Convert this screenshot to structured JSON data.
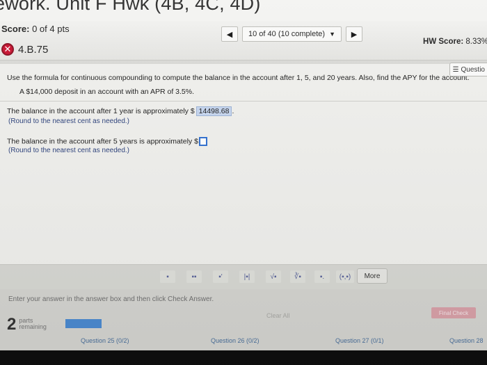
{
  "title": "ework. Unit F Hwk (4B, 4C, 4D)",
  "toolbar": {
    "score_label": "Score:",
    "score_value": "0 of 4 pts",
    "nav_position": "10 of 40 (10 complete)",
    "hw_score_label": "HW Score:",
    "hw_score_value": "8.33%",
    "question_id": "4.B.75",
    "question_list_label": "Questio"
  },
  "question": {
    "prompt": "Use the formula for continuous compounding to compute the balance in the account after 1, 5, and 20 years. Also, find the APY for the account.",
    "scenario": "A $14,000 deposit in an account with an APR of 3.5%.",
    "line1": "The balance in the account after 1 year is approximately $",
    "answer1": "14498.68",
    "answer1_suffix": ".",
    "hint1": "(Round to the nearest cent as needed.)",
    "line2": "The balance in the account after 5 years is approximately $",
    "hint2": "(Round to the nearest cent as needed.)"
  },
  "palette": {
    "tools": [
      "▪",
      "▪▪",
      "▪'",
      "|▪|",
      "√▪",
      "∛▪",
      "▪.",
      "(▪,▪)"
    ],
    "more_label": "More"
  },
  "bottom": {
    "instructions": "Enter your answer in the answer box and then click Check Answer.",
    "clear_all": "Clear All",
    "check_answer": "Final Check",
    "parts_count": "2",
    "parts_label_1": "parts",
    "parts_label_2": "remaining",
    "progress": 0.5,
    "q25": "Question 25 (0/2)",
    "q26": "Question 26 (0/2)",
    "q27": "Question 27 (0/1)",
    "q28": "Question 28"
  },
  "colors": {
    "accent_blue": "#2f6fd0",
    "wrong_red": "#c8102e",
    "answered_bg": "#c6d6ef"
  }
}
